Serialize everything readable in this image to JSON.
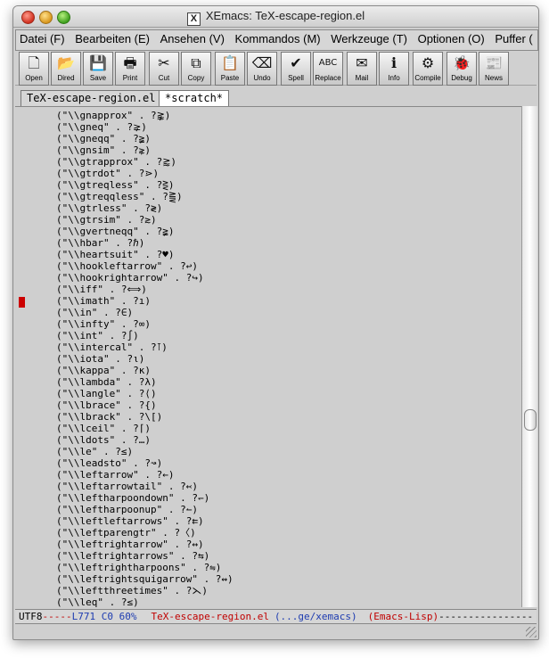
{
  "window": {
    "title": "XEmacs: TeX-escape-region.el",
    "app_icon_glyph": "X"
  },
  "menu": [
    "Datei (F)",
    "Bearbeiten (E)",
    "Ansehen (V)",
    "Kommandos (M)",
    "Werkzeuge (T)",
    "Optionen (O)",
    "Puffer ("
  ],
  "toolbar": [
    {
      "label": "Open",
      "icon": "document-icon"
    },
    {
      "label": "Dired",
      "icon": "folder-icon"
    },
    {
      "label": "Save",
      "icon": "floppy-icon"
    },
    {
      "label": "Print",
      "icon": "printer-icon"
    },
    {
      "label": "Cut",
      "icon": "scissors-icon"
    },
    {
      "label": "Copy",
      "icon": "copy-icon"
    },
    {
      "label": "Paste",
      "icon": "clipboard-icon"
    },
    {
      "label": "Undo",
      "icon": "eraser-icon"
    },
    {
      "label": "Spell",
      "icon": "spell-check-icon"
    },
    {
      "label": "Replace",
      "icon": "replace-icon"
    },
    {
      "label": "Mail",
      "icon": "mail-icon"
    },
    {
      "label": "Info",
      "icon": "info-icon"
    },
    {
      "label": "Compile",
      "icon": "compile-icon"
    },
    {
      "label": "Debug",
      "icon": "bug-icon"
    },
    {
      "label": "News",
      "icon": "newspaper-icon"
    }
  ],
  "tabs": [
    {
      "label": "TeX-escape-region.el",
      "active": true
    },
    {
      "label": "*scratch*",
      "active": false
    }
  ],
  "editor": {
    "lines": [
      "(\"\\\\gnapprox\" . ?⪊)",
      "(\"\\\\gneq\" . ?⪈)",
      "(\"\\\\gneqq\" . ?≩)",
      "(\"\\\\gnsim\" . ?⋧)",
      "(\"\\\\gtrapprox\" . ?⪆)",
      "(\"\\\\gtrdot\" . ?⋗)",
      "(\"\\\\gtreqless\" . ?⋛)",
      "(\"\\\\gtreqqless\" . ?⪌)",
      "(\"\\\\gtrless\" . ?≷)",
      "(\"\\\\gtrsim\" . ?≳)",
      "(\"\\\\gvertneqq\" . ?≩)",
      "(\"\\\\hbar\" . ?ℏ)",
      "(\"\\\\heartsuit\" . ?♥)",
      "(\"\\\\hookleftarrow\" . ?↩)",
      "(\"\\\\hookrightarrow\" . ?↪)",
      "(\"\\\\iff\" . ?⟺)",
      "(\"\\\\imath\" . ?ı)",
      "(\"\\\\in\" . ?∈)",
      "(\"\\\\infty\" . ?∞)",
      "(\"\\\\int\" . ?∫)",
      "(\"\\\\intercal\" . ?⊺)",
      "(\"\\\\iota\" . ?ι)",
      "(\"\\\\kappa\" . ?κ)",
      "(\"\\\\lambda\" . ?λ)",
      "(\"\\\\langle\" . ?⟨)",
      "(\"\\\\lbrace\" . ?{)",
      "(\"\\\\lbrack\" . ?\\[)",
      "(\"\\\\lceil\" . ?⌈)",
      "(\"\\\\ldots\" . ?…)",
      "(\"\\\\le\" . ?≤)",
      "(\"\\\\leadsto\" . ?↝)",
      "(\"\\\\leftarrow\" . ?←)",
      "(\"\\\\leftarrowtail\" . ?↢)",
      "(\"\\\\leftharpoondown\" . ?↽)",
      "(\"\\\\leftharpoonup\" . ?↼)",
      "(\"\\\\leftleftarrows\" . ?⇇)",
      "(\"\\\\leftparengtr\" . ?〈)",
      "(\"\\\\leftrightarrow\" . ?↔)",
      "(\"\\\\leftrightarrows\" . ?⇆)",
      "(\"\\\\leftrightharpoons\" . ?⇋)",
      "(\"\\\\leftrightsquigarrow\" . ?↭)",
      "(\"\\\\leftthreetimes\" . ?⋋)",
      "(\"\\\\leq\" . ?≤)"
    ],
    "cursor_line": 16
  },
  "modeline": {
    "coding": "UTF8",
    "dash_left": "-----",
    "position": "L771 C0 60%",
    "buffer": "TeX-escape-region.el",
    "directory": "(...ge/xemacs)",
    "mode": "(Emacs-Lisp)",
    "fill": "----------------"
  },
  "colors": {
    "cursor": "#cc0000",
    "modeline_red": "#c00000",
    "modeline_blue": "#1d3bb0",
    "background": "#cfcfcf"
  }
}
